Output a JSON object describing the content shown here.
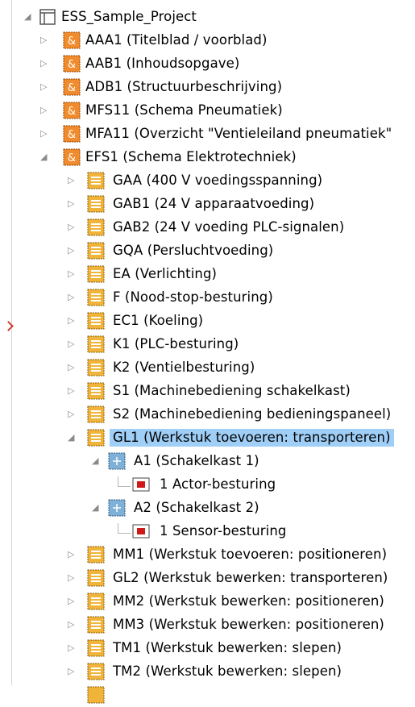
{
  "tree": {
    "root": {
      "label": "ESS_Sample_Project"
    },
    "pages": [
      {
        "label": "AAA1 (Titelblad / voorblad)"
      },
      {
        "label": "AAB1 (Inhoudsopgave)"
      },
      {
        "label": "ADB1 (Structuurbeschrijving)"
      },
      {
        "label": "MFS11 (Schema Pneumatiek)"
      },
      {
        "label": "MFA11 (Overzicht \"Ventieleiland pneumatiek\""
      },
      {
        "label": "EFS1 (Schema Elektrotechniek)"
      }
    ],
    "functions": [
      {
        "label": "GAA (400 V voedingsspanning)"
      },
      {
        "label": "GAB1 (24 V apparaatvoeding)"
      },
      {
        "label": "GAB2 (24 V voeding PLC-signalen)"
      },
      {
        "label": "GQA (Persluchtvoeding)"
      },
      {
        "label": "EA (Verlichting)"
      },
      {
        "label": "F (Nood-stop-besturing)"
      },
      {
        "label": "EC1 (Koeling)"
      },
      {
        "label": "K1 (PLC-besturing)"
      },
      {
        "label": "K2 (Ventielbesturing)"
      },
      {
        "label": "S1 (Machinebediening schakelkast)"
      },
      {
        "label": "S2 (Machinebediening bedieningspaneel)"
      },
      {
        "label": "GL1 (Werkstuk toevoeren: transporteren)"
      }
    ],
    "cabinets": [
      {
        "label": "A1 (Schakelkast 1)",
        "child": "1 Actor-besturing"
      },
      {
        "label": "A2 (Schakelkast 2)",
        "child": "1 Sensor-besturing"
      }
    ],
    "functions_after": [
      {
        "label": "MM1 (Werkstuk toevoeren: positioneren)"
      },
      {
        "label": "GL2 (Werkstuk bewerken: transporteren)"
      },
      {
        "label": "MM2 (Werkstuk bewerken: positioneren)"
      },
      {
        "label": "MM3 (Werkstuk bewerken: positioneren)"
      },
      {
        "label": "TM1 (Werkstuk bewerken: slepen)"
      },
      {
        "label": "TM2 (Werkstuk bewerken: slepen)"
      }
    ]
  },
  "colors": {
    "selection": "#9fcef6",
    "page_icon": "#f28b2c",
    "function_icon": "#f0b43a",
    "cabinet_icon": "#7fb0d8",
    "device_icon": "#d01818"
  }
}
